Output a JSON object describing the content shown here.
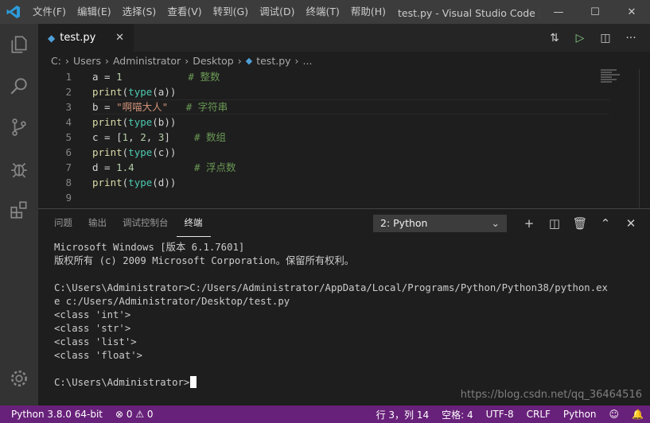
{
  "window": {
    "menu": [
      "文件(F)",
      "编辑(E)",
      "选择(S)",
      "查看(V)",
      "转到(G)",
      "调试(D)",
      "终端(T)",
      "帮助(H)"
    ],
    "title": "test.py - Visual Studio Code [管...",
    "controls": {
      "minimize": "—",
      "maximize": "☐",
      "close": "✕"
    }
  },
  "activity_bar": [
    "explorer-icon",
    "search-icon",
    "source-control-icon",
    "debug-icon",
    "extensions-icon",
    "settings-gear-icon"
  ],
  "editor": {
    "tab": {
      "label": "test.py",
      "close": "✕"
    },
    "breadcrumb": [
      "C:",
      "Users",
      "Administrator",
      "Desktop",
      "test.py",
      "..."
    ],
    "lines": [
      {
        "num": "1",
        "tokens": [
          {
            "t": "a = ",
            "c": "plain"
          },
          {
            "t": "1",
            "c": "num"
          },
          {
            "t": "           # 整数",
            "c": "cmt"
          }
        ]
      },
      {
        "num": "2",
        "tokens": [
          {
            "t": "print",
            "c": "fn"
          },
          {
            "t": "(",
            "c": "plain"
          },
          {
            "t": "type",
            "c": "type"
          },
          {
            "t": "(a))",
            "c": "plain"
          }
        ]
      },
      {
        "num": "3",
        "tokens": [
          {
            "t": "b = ",
            "c": "plain"
          },
          {
            "t": "\"啊喵大人\"",
            "c": "str"
          },
          {
            "t": "   # 字符串",
            "c": "cmt"
          }
        ]
      },
      {
        "num": "4",
        "tokens": [
          {
            "t": "print",
            "c": "fn"
          },
          {
            "t": "(",
            "c": "plain"
          },
          {
            "t": "type",
            "c": "type"
          },
          {
            "t": "(b))",
            "c": "plain"
          }
        ]
      },
      {
        "num": "5",
        "tokens": [
          {
            "t": "c = [",
            "c": "plain"
          },
          {
            "t": "1",
            "c": "num"
          },
          {
            "t": ", ",
            "c": "plain"
          },
          {
            "t": "2",
            "c": "num"
          },
          {
            "t": ", ",
            "c": "plain"
          },
          {
            "t": "3",
            "c": "num"
          },
          {
            "t": "]",
            "c": "plain"
          },
          {
            "t": "    # 数组",
            "c": "cmt"
          }
        ]
      },
      {
        "num": "6",
        "tokens": [
          {
            "t": "print",
            "c": "fn"
          },
          {
            "t": "(",
            "c": "plain"
          },
          {
            "t": "type",
            "c": "type"
          },
          {
            "t": "(c))",
            "c": "plain"
          }
        ]
      },
      {
        "num": "7",
        "tokens": [
          {
            "t": "d = ",
            "c": "plain"
          },
          {
            "t": "1.4",
            "c": "num"
          },
          {
            "t": "          # 浮点数",
            "c": "cmt"
          }
        ]
      },
      {
        "num": "8",
        "tokens": [
          {
            "t": "print",
            "c": "fn"
          },
          {
            "t": "(",
            "c": "plain"
          },
          {
            "t": "type",
            "c": "type"
          },
          {
            "t": "(d))",
            "c": "plain"
          }
        ]
      },
      {
        "num": "9",
        "tokens": []
      }
    ]
  },
  "panel": {
    "tabs": [
      "问题",
      "输出",
      "调试控制台",
      "终端"
    ],
    "active_tab": "终端",
    "terminal_select": "2: Python",
    "terminal_lines": [
      "Microsoft Windows [版本 6.1.7601]",
      "版权所有 (c) 2009 Microsoft Corporation。保留所有权利。",
      "",
      "C:\\Users\\Administrator>C:/Users/Administrator/AppData/Local/Programs/Python/Python38/python.ex",
      "e c:/Users/Administrator/Desktop/test.py",
      "<class 'int'>",
      "<class 'str'>",
      "<class 'list'>",
      "<class 'float'>",
      "",
      "C:\\Users\\Administrator>"
    ],
    "watermark": "https://blog.csdn.net/qq_36464516"
  },
  "status_bar": {
    "python": "Python 3.8.0 64-bit",
    "problems": "⊗ 0 ⚠ 0",
    "position": "行 3，列 14",
    "spaces": "空格: 4",
    "encoding": "UTF-8",
    "eol": "CRLF",
    "language": "Python",
    "feedback": "☺",
    "bell": "🔔"
  }
}
